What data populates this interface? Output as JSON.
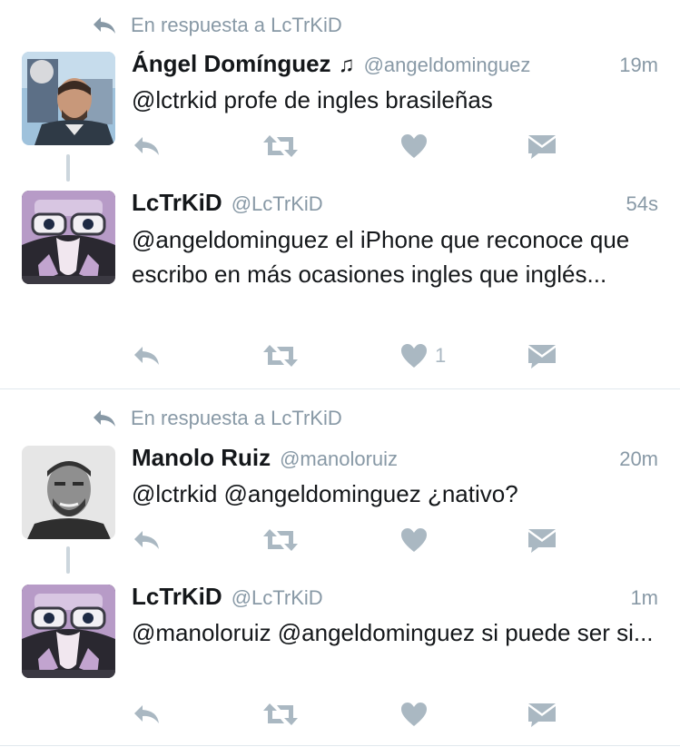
{
  "colors": {
    "secondary": "#8899a6",
    "action": "#aab8c2",
    "divider": "#e1e8ed",
    "text": "#14171a"
  },
  "conversations": [
    {
      "reply_context": {
        "icon": "reply-icon",
        "label": "En respuesta a LcTrKiD"
      },
      "tweets": [
        {
          "avatar": "avatar-angel-dominguez",
          "name": "Ángel Domínguez",
          "name_suffix": "♫",
          "handle": "@angeldominguez",
          "time": "19m",
          "text": "@lctrkid profe de ingles brasileñas",
          "like_count": ""
        },
        {
          "avatar": "avatar-lctrkid",
          "name": "LcTrKiD",
          "handle": "@LcTrKiD",
          "time": "54s",
          "text": "@angeldominguez el iPhone que reconoce que escribo en más ocasiones ingles que inglés...",
          "like_count": "1"
        }
      ]
    },
    {
      "reply_context": {
        "icon": "reply-icon",
        "label": "En respuesta a LcTrKiD"
      },
      "tweets": [
        {
          "avatar": "avatar-manolo-ruiz",
          "name": "Manolo Ruiz",
          "handle": "@manoloruiz",
          "time": "20m",
          "text": "@lctrkid @angeldominguez ¿nativo?",
          "like_count": ""
        },
        {
          "avatar": "avatar-lctrkid",
          "name": "LcTrKiD",
          "handle": "@LcTrKiD",
          "time": "1m",
          "text": "@manoloruiz @angeldominguez si puede ser si...",
          "like_count": ""
        }
      ]
    }
  ],
  "action_icons": [
    "reply-icon",
    "retweet-icon",
    "heart-icon",
    "direct-message-icon"
  ]
}
